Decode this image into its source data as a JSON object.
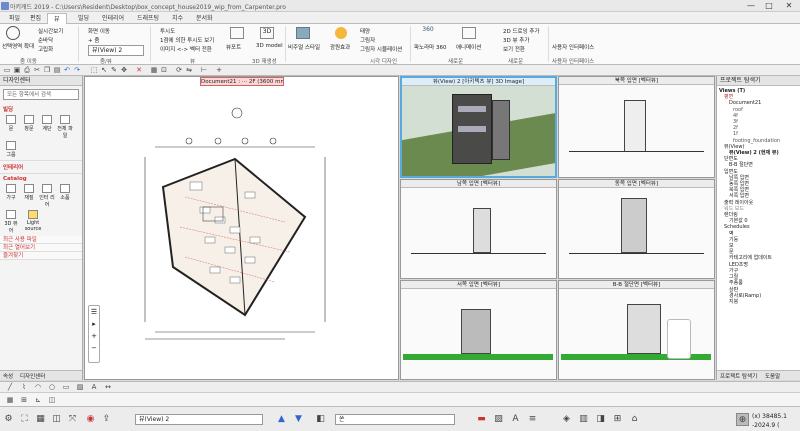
{
  "window": {
    "title": "아키캐드 2019 - C:\\Users\\Resident\\Desktop\\box_concept_house2019_wip_from_Carpenter.pro",
    "minimize": "—",
    "maximize": "□",
    "close": "✕"
  },
  "tabs": [
    "파일",
    "편집",
    "뷰",
    "빌딩",
    "인테리어",
    "드래프팅",
    "치수",
    "문서화"
  ],
  "search": {
    "placeholder": "찾기"
  },
  "ribbon": {
    "nav": {
      "select_area": "선택영역 확대",
      "pan": "이동",
      "fit": "고립화",
      "realtime": "실시간보기",
      "orbit": "순바닥",
      "group": "줌 이동"
    },
    "zoom": {
      "pan2": "화면 이동",
      "zoom_in": "+ 줌",
      "view_combo": "뷰(View) 2",
      "group": "줌/뷰"
    },
    "view": {
      "prev_view": "이전 뷰로 돌아가기",
      "through": "1점에 의한 투시도 보기",
      "image_vector": "이미지 <-> 벡터 전환",
      "persp": "투시도",
      "group": "뷰"
    },
    "3d": {
      "floor": "뷰포트",
      "model": "3D model",
      "group": "3D 재생성"
    },
    "style": {
      "style_name": "비주얼 스타일",
      "lights": "광원효과",
      "sun": "태양",
      "shadow": "그림자",
      "shadow_sim": "그림자 시뮬레이션",
      "group": "시각 디자인"
    },
    "pano": {
      "pano": "파노라마 360",
      "anim": "애니메이션",
      "group": "새로운"
    },
    "render": {
      "add_2d": "2D 드로잉 추가",
      "add_3d": "3D 뷰 추가",
      "switch": "보기 전환",
      "group": "새로운"
    },
    "ui": {
      "user_iface": "사용자 인터페이스",
      "group": "사용자 인터페이스"
    }
  },
  "left_panel": {
    "title": "디자인센터",
    "search_placeholder": "모든 항목에서 검색",
    "categories": {
      "building": "빌딩",
      "building_items": [
        "문",
        "창문",
        "계단",
        "전체 파일",
        "그룹"
      ],
      "interior": "인테리어",
      "catalog": "Catalog",
      "catalog_items": [
        "가구",
        "재질",
        "인터 리어",
        "소품",
        "3D 뷰 어",
        "Light source"
      ]
    },
    "links": [
      "최근 사용 파일",
      "최근 열어보기",
      "즐겨찾기"
    ],
    "tabs": [
      "속성",
      "디자인센터"
    ]
  },
  "canvas": {
    "tab_label": "Document21 : ··· 2F (3600 mm)"
  },
  "views": [
    {
      "title": "뷰(View) 2 [아키텍츠 뷰] 3D Image]",
      "selected": true
    },
    {
      "title": "북쪽 입면 [벡터뷰]"
    },
    {
      "title": "남쪽 입면 [벡터뷰]"
    },
    {
      "title": "동쪽 입면 [벡터뷰]"
    },
    {
      "title": "서쪽 입면 [벡터뷰]"
    },
    {
      "title": "B-B 절단면 [벡터뷰]"
    }
  ],
  "right_panel": {
    "title": "프로젝트 탐색기",
    "tree": [
      "Views (T)",
      "평면",
      "Document21",
      "roof",
      "4f",
      "3f",
      "2f",
      "1f",
      "footing_foundation",
      "뷰(View)",
      "뷰(View) 2 (현재 뷰)",
      "단면도",
      "B-B 절단면",
      "입면도",
      "남쪽 입면",
      "동쪽 입면",
      "북쪽 입면",
      "서쪽 입면",
      "출력 레이아웃",
      "워드 보드",
      "렌더링",
      "기본값 0",
      "Schedules",
      "벽",
      "기둥",
      "보",
      "문",
      "카테고리에 업데이트",
      "LED조명",
      "가구",
      "그릴",
      "주종룸",
      "상판",
      "경사로(Ramp)",
      "지붕"
    ],
    "tabs": [
      "프로젝트 탐색기",
      "도움말"
    ]
  },
  "bottom": {
    "view_select": "뷰(View) 2",
    "plane_combo": "쏜"
  },
  "status": {
    "coords": "(x) 38485.1",
    "coords2": "-2024.9 (",
    "scale": "1:50"
  }
}
